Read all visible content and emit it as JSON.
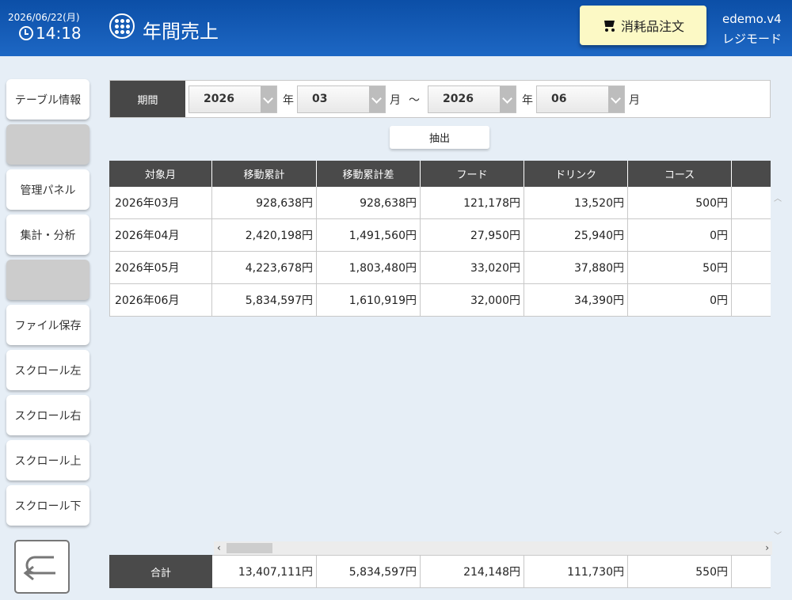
{
  "header": {
    "date": "2026/06/22(月)",
    "time": "14:18",
    "title": "年間売上",
    "order_button": "消耗品注文",
    "version": "edemo.v4",
    "mode": "レジモード"
  },
  "sidebar": {
    "items": [
      {
        "label": "テーブル情報"
      },
      {
        "label": ""
      },
      {
        "label": "管理パネル"
      },
      {
        "label": "集計・分析"
      },
      {
        "label": ""
      },
      {
        "label": "ファイル保存"
      },
      {
        "label": "スクロール左"
      },
      {
        "label": "スクロール右"
      },
      {
        "label": "スクロール上"
      },
      {
        "label": "スクロール下"
      }
    ]
  },
  "filter": {
    "label": "期間",
    "from_year": "2026",
    "from_month": "03",
    "to_year": "2026",
    "to_month": "06",
    "year_unit": "年",
    "month_unit": "月",
    "range_sep": "～",
    "extract_button": "抽出"
  },
  "table": {
    "columns": [
      "対象月",
      "移動累計",
      "移動累計差",
      "フード",
      "ドリンク",
      "コース",
      ""
    ],
    "rows": [
      [
        "2026年03月",
        "928,638円",
        "928,638円",
        "121,178円",
        "13,520円",
        "500円",
        ""
      ],
      [
        "2026年04月",
        "2,420,198円",
        "1,491,560円",
        "27,950円",
        "25,940円",
        "0円",
        ""
      ],
      [
        "2026年05月",
        "4,223,678円",
        "1,803,480円",
        "33,020円",
        "37,880円",
        "50円",
        ""
      ],
      [
        "2026年06月",
        "5,834,597円",
        "1,610,919円",
        "32,000円",
        "34,390円",
        "0円",
        ""
      ]
    ],
    "total_label": "合計",
    "totals": [
      "13,407,111円",
      "5,834,597円",
      "214,148円",
      "111,730円",
      "550円",
      ""
    ]
  },
  "colors": {
    "header_bg": "#1558b4",
    "accent_button": "#fcf9c5",
    "table_header": "#4a4a4a",
    "page_bg": "#e6eef6"
  },
  "icons": {
    "clock": "clock-icon",
    "menu": "grid-menu-icon",
    "cart": "cart-icon",
    "back": "return-arrow-icon"
  }
}
